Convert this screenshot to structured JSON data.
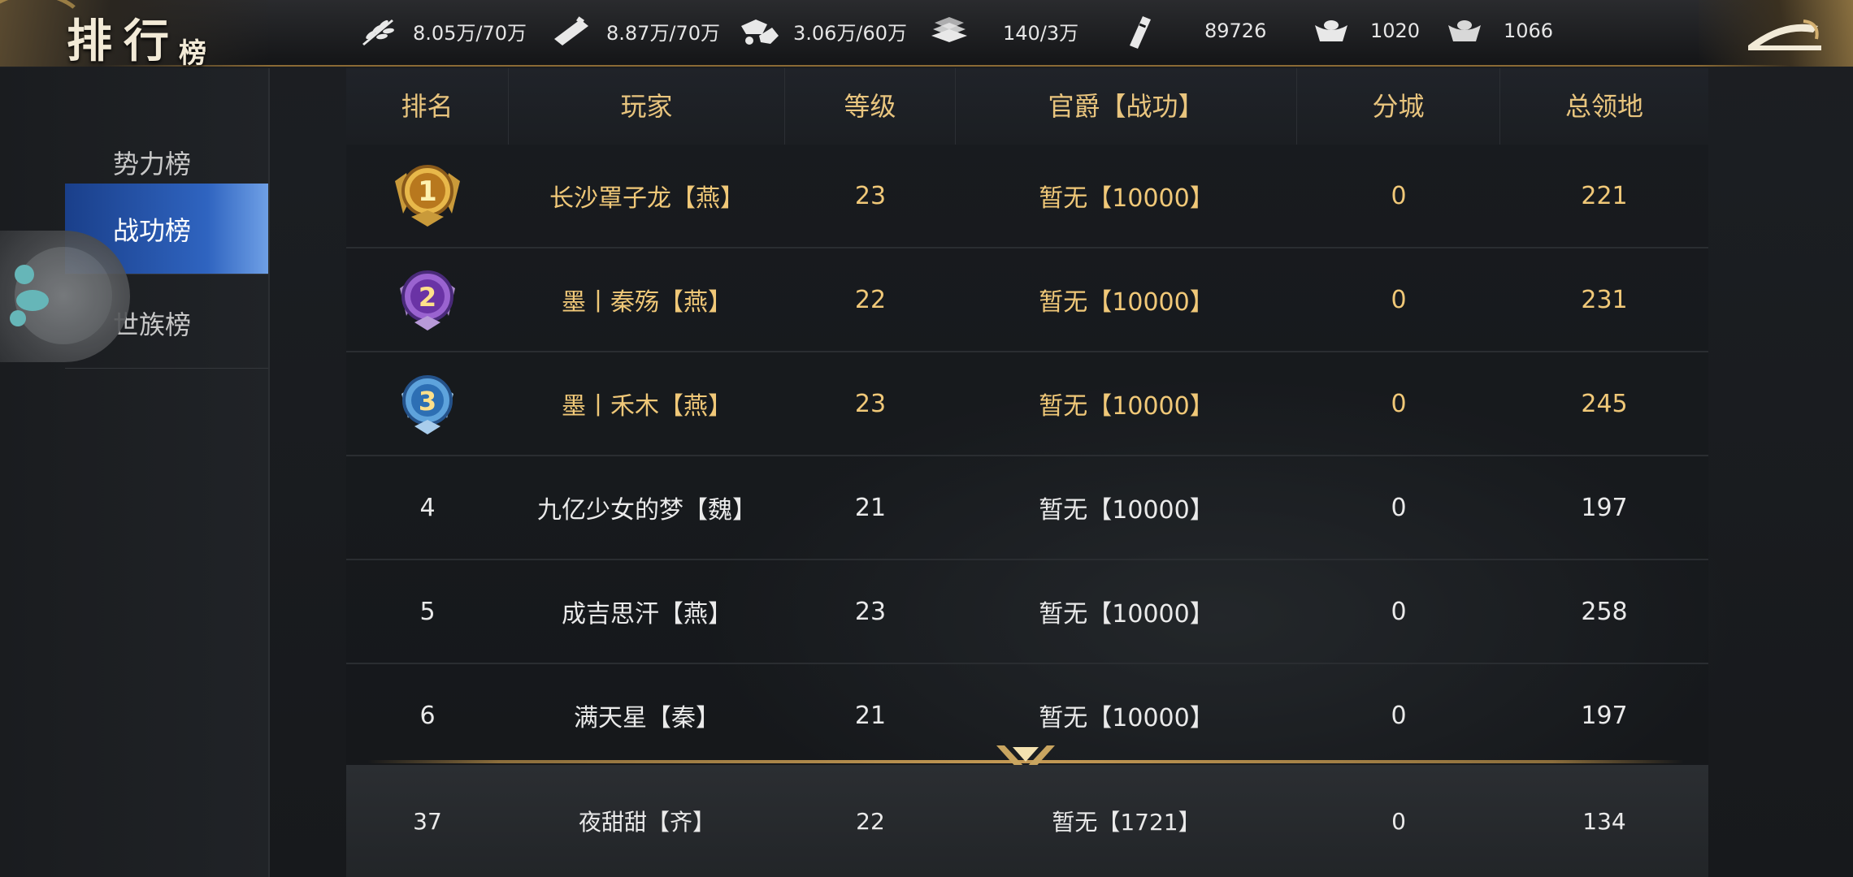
{
  "header": {
    "title_main": "排行",
    "title_sub": "榜",
    "resources": [
      {
        "icon": "grain-icon",
        "value": "8.05万/70万"
      },
      {
        "icon": "wood-icon",
        "value": "8.87万/70万"
      },
      {
        "icon": "stone-icon",
        "value": "3.06万/60万"
      },
      {
        "icon": "iron-icon",
        "value": "140/3万"
      },
      {
        "icon": "copper-coin-icon",
        "value": "89726"
      },
      {
        "icon": "gold-ingot-icon",
        "value": "1020"
      },
      {
        "icon": "silver-ingot-icon",
        "value": "1066"
      }
    ]
  },
  "sidebar": {
    "items": [
      {
        "label": "势力榜",
        "active": false
      },
      {
        "label": "战功榜",
        "active": true
      },
      {
        "label": "世族榜",
        "active": false
      }
    ]
  },
  "table": {
    "headers": [
      "排名",
      "玩家",
      "等级",
      "官爵【战功】",
      "分城",
      "总领地"
    ],
    "rows": [
      {
        "rank": "1",
        "player": "长沙罩子龙【燕】",
        "level": "23",
        "title": "暂无【10000】",
        "branch": "0",
        "territory": "221"
      },
      {
        "rank": "2",
        "player": "墨丨秦殇【燕】",
        "level": "22",
        "title": "暂无【10000】",
        "branch": "0",
        "territory": "231"
      },
      {
        "rank": "3",
        "player": "墨丨禾木【燕】",
        "level": "23",
        "title": "暂无【10000】",
        "branch": "0",
        "territory": "245"
      },
      {
        "rank": "4",
        "player": "九亿少女的梦【魏】",
        "level": "21",
        "title": "暂无【10000】",
        "branch": "0",
        "territory": "197"
      },
      {
        "rank": "5",
        "player": "成吉思汗【燕】",
        "level": "23",
        "title": "暂无【10000】",
        "branch": "0",
        "territory": "258"
      },
      {
        "rank": "6",
        "player": "满天星【秦】",
        "level": "21",
        "title": "暂无【10000】",
        "branch": "0",
        "territory": "197"
      }
    ],
    "my_row": {
      "rank": "37",
      "player": "夜甜甜【齐】",
      "level": "22",
      "title": "暂无【1721】",
      "branch": "0",
      "territory": "134"
    }
  },
  "colors": {
    "gold_text": "#f0c878",
    "header_text": "#e9c57e",
    "active_tab": "#2f64c0",
    "divider_gold": "#c59a55"
  }
}
